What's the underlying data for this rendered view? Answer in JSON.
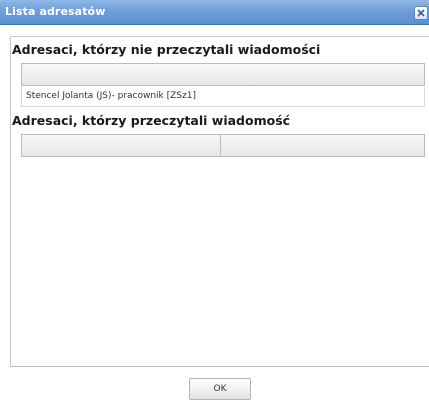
{
  "window": {
    "title": "Lista adresatów",
    "close_icon": "close-icon"
  },
  "sections": {
    "unread": {
      "heading": "Adresaci, którzy nie przeczytali wiadomości",
      "rows": [
        "Stencel Jolanta (JS)- pracownik [ZSz1]"
      ]
    },
    "read": {
      "heading": "Adresaci, którzy przeczytali wiadomość",
      "rows": []
    }
  },
  "footer": {
    "ok_label": "OK"
  },
  "colors": {
    "titlebar": "#6f9fd8",
    "titlebar_text": "#ffffff",
    "header_bar": "#eeeeee",
    "border": "#bcbcbc"
  }
}
